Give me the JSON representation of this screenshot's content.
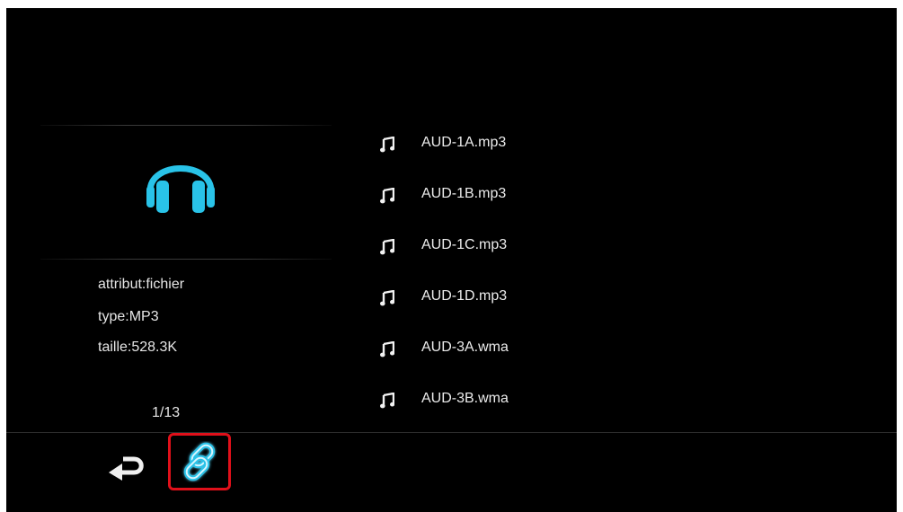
{
  "colors": {
    "background": "#000000",
    "accent": "#29c3e8",
    "text": "#e6e6e6",
    "highlight_border": "#e0101a"
  },
  "preview": {
    "icon": "headphones-icon",
    "info": [
      "attribut:fichier",
      "type:MP3",
      "taille:528.3K"
    ],
    "page_counter": "1/13"
  },
  "files": [
    {
      "icon": "music-note-icon",
      "name": "AUD-1A.mp3"
    },
    {
      "icon": "music-note-icon",
      "name": "AUD-1B.mp3"
    },
    {
      "icon": "music-note-icon",
      "name": "AUD-1C.mp3"
    },
    {
      "icon": "music-note-icon",
      "name": "AUD-1D.mp3"
    },
    {
      "icon": "music-note-icon",
      "name": "AUD-3A.wma"
    },
    {
      "icon": "music-note-icon",
      "name": "AUD-3B.wma"
    }
  ],
  "toolbar": {
    "back_icon": "return-arrow-icon",
    "link_icon": "chain-link-icon",
    "link_selected": true
  }
}
